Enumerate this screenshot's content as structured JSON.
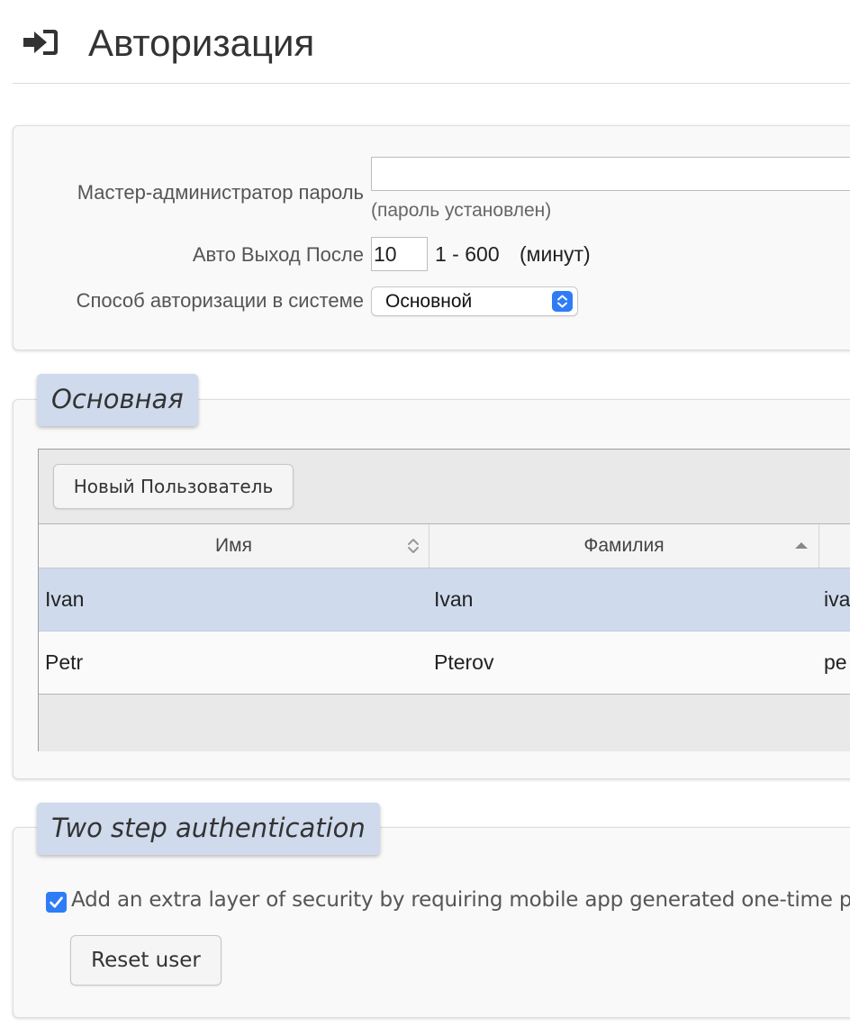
{
  "header": {
    "title": "Авторизация",
    "icon": "sign-in-icon"
  },
  "settings": {
    "master_password_label": "Мастер-администратор пароль",
    "master_password_value": "",
    "master_password_note": "(пароль установлен)",
    "auto_logout_label": "Авто Выход После",
    "auto_logout_value": "10",
    "auto_logout_range": "1 - 600",
    "auto_logout_unit": "(минут)",
    "auth_method_label": "Способ авторизации в системе",
    "auth_method_value": "Основной"
  },
  "users_section": {
    "legend": "Основная",
    "new_user_button": "Новый Пользователь",
    "columns": [
      {
        "label": "Имя",
        "sort": "none"
      },
      {
        "label": "Фамилия",
        "sort": "ascending"
      },
      {
        "label": ""
      }
    ],
    "rows": [
      {
        "cells": [
          "Ivan",
          "Ivan",
          "iva"
        ],
        "selected": true
      },
      {
        "cells": [
          "Petr",
          "Pterov",
          "pe"
        ],
        "selected": false
      }
    ]
  },
  "two_step": {
    "legend": "Two step authentication",
    "checkbox_checked": true,
    "checkbox_label": "Add an extra layer of security by requiring mobile app generated one-time pas",
    "reset_button": "Reset user"
  },
  "colors": {
    "accent": "#2f7df6",
    "legend_bg": "#cfdaed",
    "selected_row": "#cfdaed"
  }
}
